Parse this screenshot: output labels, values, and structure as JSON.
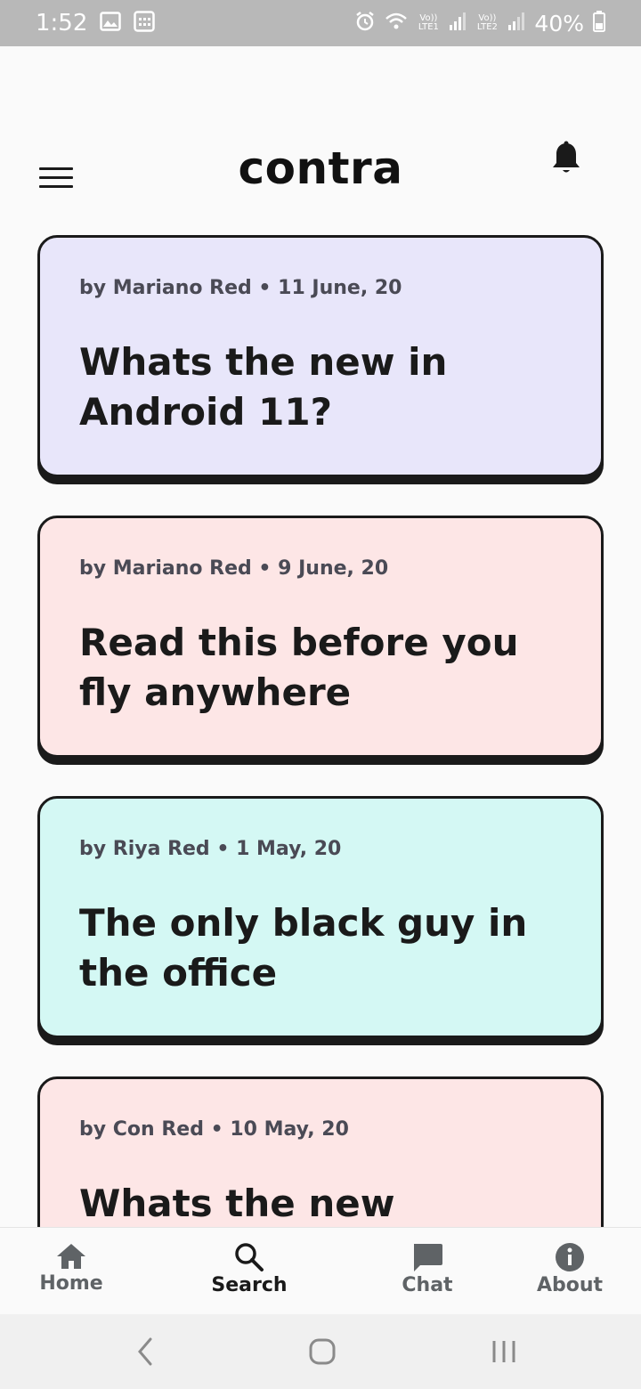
{
  "status_bar": {
    "time": "1:52",
    "lte1": "Vo)) LTE1",
    "lte2": "Vo)) LTE2",
    "battery": "40%",
    "icons": [
      "image-icon",
      "keyboard-icon",
      "alarm-icon",
      "wifi-icon",
      "signal-icon",
      "signal-icon",
      "battery-icon"
    ]
  },
  "header": {
    "title": "contra",
    "icons": [
      "menu-icon",
      "bell-icon"
    ]
  },
  "posts": [
    {
      "author": "by Mariano Red",
      "date": "11 June, 20",
      "meta": "by Mariano Red • 11 June, 20",
      "title": "Whats the new in Android 11?",
      "color": "#e8e6fa"
    },
    {
      "author": "by Mariano Red",
      "date": "9 June, 20",
      "meta": "by Mariano Red • 9 June, 20",
      "title": "Read this before you fly anywhere",
      "color": "#fde6e6"
    },
    {
      "author": "by Riya Red",
      "date": "1 May, 20",
      "meta": "by Riya Red • 1 May, 20",
      "title": "The only black guy in the office",
      "color": "#d4f8f4"
    },
    {
      "author": "by Con Red",
      "date": "10 May, 20",
      "meta": "by Con Red • 10 May, 20",
      "title": "Whats the new",
      "color": "#fde6e6"
    }
  ],
  "bottom_nav": {
    "items": [
      {
        "label": "Home",
        "icon": "home-icon",
        "active": false
      },
      {
        "label": "Search",
        "icon": "search-icon",
        "active": true
      },
      {
        "label": "Chat",
        "icon": "chat-icon",
        "active": false
      },
      {
        "label": "About",
        "icon": "info-icon",
        "active": false
      }
    ]
  },
  "system_nav": {
    "icons": [
      "back-icon",
      "home-circle-icon",
      "recents-icon"
    ]
  },
  "colors": {
    "status_bar": "#b8b8b8",
    "background": "#fafafa",
    "card_border": "#1a1a1a",
    "muted_text": "#4a4a55"
  }
}
